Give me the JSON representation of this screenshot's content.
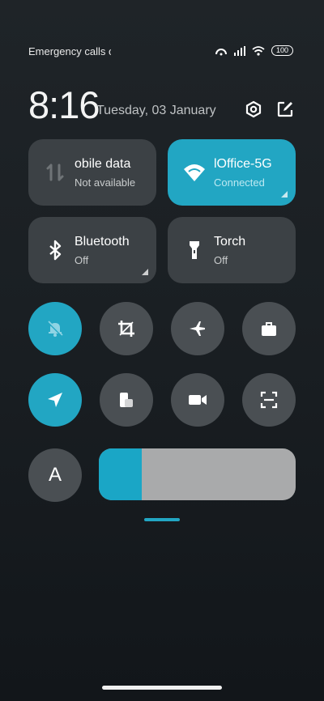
{
  "status": {
    "carrier_text": "Emergency calls o",
    "battery": "100"
  },
  "header": {
    "time": "8:16",
    "date": "Tuesday, 03 January"
  },
  "tiles": {
    "mobile_data": {
      "title": "obile data",
      "subtitle": "Not available"
    },
    "wifi": {
      "title": "lOffice-5G",
      "subtitle": "Connected"
    },
    "bluetooth": {
      "title": "Bluetooth",
      "subtitle": "Off"
    },
    "torch": {
      "title": "Torch",
      "subtitle": "Off"
    }
  },
  "toggles": {
    "row1": [
      "bell-off-icon",
      "crop-icon",
      "airplane-icon",
      "briefcase-icon"
    ],
    "row2": [
      "location-arrow-icon",
      "split-screen-icon",
      "video-camera-icon",
      "scan-icon"
    ]
  },
  "brightness": {
    "auto_label": "A",
    "level_fraction": 0.22
  },
  "colors": {
    "accent": "#22a6c3",
    "tile_bg": "#3c4145",
    "circle_bg": "#4a4f53"
  }
}
